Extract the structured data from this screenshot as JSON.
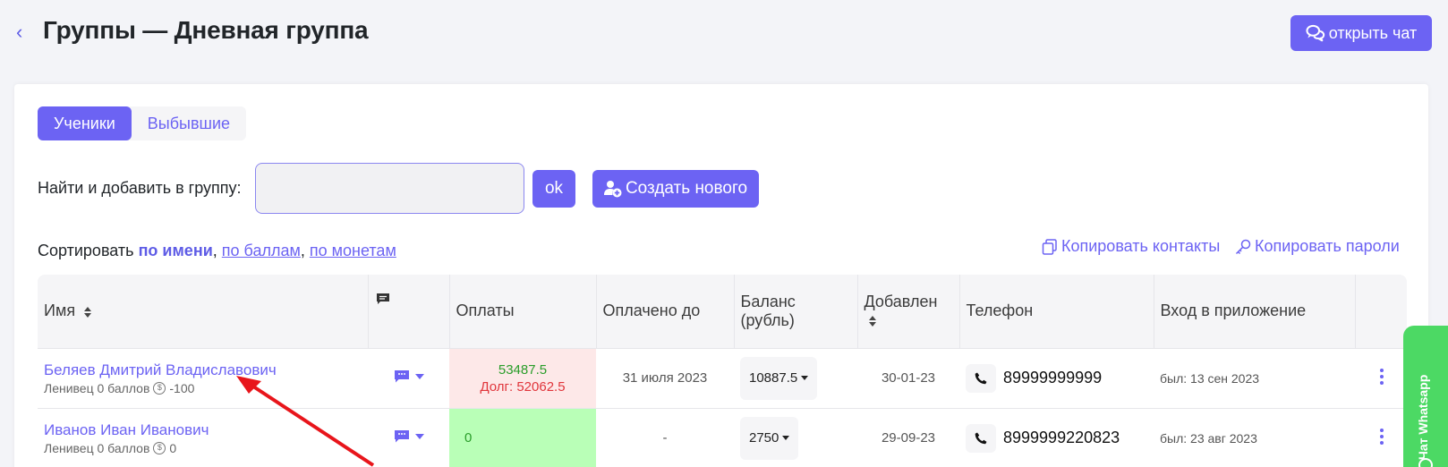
{
  "header": {
    "title": "Группы — Дневная группа",
    "chat_button": "открыть чат"
  },
  "tabs": [
    {
      "label": "Ученики",
      "active": true
    },
    {
      "label": "Выбывшие",
      "active": false
    }
  ],
  "find": {
    "label": "Найти и добавить в группу:",
    "input_value": "",
    "ok_label": "ok",
    "create_label": "Создать нового"
  },
  "sort": {
    "prefix": "Сортировать",
    "by_name": "по имени",
    "by_points": "по баллам",
    "by_coins": "по монетам",
    "sep": ","
  },
  "actions": {
    "copy_contacts": "Копировать контакты",
    "copy_passwords": "Копировать пароли"
  },
  "table": {
    "headers": {
      "name": "Имя",
      "payments": "Оплаты",
      "paid_until": "Оплачено до",
      "balance_line1": "Баланс",
      "balance_line2": "(рубль)",
      "added": "Добавлен",
      "phone": "Телефон",
      "login": "Вход в приложение"
    },
    "rows": [
      {
        "name": "Беляев Дмитрий Владиславович",
        "sub": "Ленивец 0 баллов",
        "coins": "-100",
        "payment": "53487.5",
        "debt": "Долг: 52062.5",
        "paid_until": "31 июля 2023",
        "balance": "10887.5",
        "added": "30-01-23",
        "phone": "89999999999",
        "login": "был: 13 сен 2023"
      },
      {
        "name": "Иванов Иван Иванович",
        "sub": "Ленивец 0 баллов",
        "coins": "0",
        "payment": "0",
        "debt": "",
        "paid_until": "-",
        "balance": "2750",
        "added": "29-09-23",
        "phone": "8999999220823",
        "login": "был: 23 авг 2023"
      }
    ]
  },
  "whatsapp": {
    "label": "Чат Whatsapp",
    "color": "#4cd964"
  },
  "colors": {
    "accent": "#6c63f3",
    "debt_bg": "#fde8e8",
    "paid_bg": "#b9ffb7",
    "debt_text": "#e0353b",
    "paid_text": "#2a9d2a",
    "annotation_arrow": "#e8151b"
  }
}
